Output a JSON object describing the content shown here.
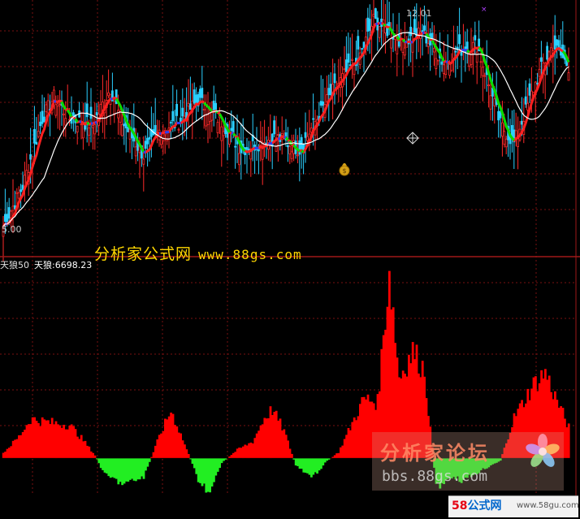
{
  "chart_data": [
    {
      "type": "candlestick",
      "ylim": [
        5.0,
        12.5
      ],
      "price_labels": {
        "low": "5.00",
        "high": "12.01"
      },
      "seed": 7,
      "keypoints": [
        [
          0,
          5.3
        ],
        [
          10,
          6.6
        ],
        [
          20,
          8.8
        ],
        [
          26,
          9.5
        ],
        [
          34,
          8.8
        ],
        [
          46,
          8.6
        ],
        [
          55,
          9.8
        ],
        [
          60,
          8.8
        ],
        [
          72,
          7.6
        ],
        [
          80,
          8.4
        ],
        [
          90,
          8.7
        ],
        [
          100,
          9.4
        ],
        [
          112,
          8.7
        ],
        [
          122,
          7.8
        ],
        [
          140,
          8.2
        ],
        [
          152,
          7.8
        ],
        [
          168,
          9.6
        ],
        [
          184,
          11.0
        ],
        [
          190,
          12.0
        ],
        [
          205,
          11.3
        ],
        [
          215,
          11.6
        ],
        [
          226,
          10.6
        ],
        [
          232,
          11.0
        ],
        [
          243,
          11.2
        ],
        [
          255,
          8.6
        ],
        [
          262,
          8.0
        ],
        [
          275,
          10.3
        ],
        [
          282,
          11.2
        ],
        [
          290,
          10.5
        ]
      ],
      "ma_lines": [
        {
          "name": "",
          "period": 5,
          "color": "#ff2020",
          "width": 3.0
        },
        {
          "name": "",
          "period": 22,
          "color": "#ffffff",
          "width": 1.2
        }
      ],
      "highlight_colors": {
        "down": "#00e000",
        "flat": "#2040ff"
      }
    },
    {
      "type": "bar",
      "indicator_label": "天狼50",
      "series_name": "天狼",
      "series_value": "6698.23",
      "ylim": [
        -1500,
        8000
      ],
      "zero": 0,
      "keypoints": [
        [
          0,
          220
        ],
        [
          8,
          900
        ],
        [
          14,
          1650
        ],
        [
          24,
          1500
        ],
        [
          34,
          1400
        ],
        [
          40,
          850
        ],
        [
          47,
          120
        ],
        [
          52,
          -700
        ],
        [
          62,
          -1100
        ],
        [
          72,
          -800
        ],
        [
          80,
          900
        ],
        [
          86,
          2000
        ],
        [
          90,
          1200
        ],
        [
          96,
          -50
        ],
        [
          100,
          -900
        ],
        [
          106,
          -1450
        ],
        [
          112,
          -200
        ],
        [
          120,
          350
        ],
        [
          128,
          700
        ],
        [
          134,
          1700
        ],
        [
          138,
          2050
        ],
        [
          144,
          1150
        ],
        [
          150,
          -300
        ],
        [
          158,
          -850
        ],
        [
          166,
          -120
        ],
        [
          172,
          250
        ],
        [
          178,
          1300
        ],
        [
          185,
          2500
        ],
        [
          192,
          2350
        ],
        [
          198,
          7900
        ],
        [
          203,
          3400
        ],
        [
          210,
          4500
        ],
        [
          216,
          3700
        ],
        [
          222,
          -1250
        ],
        [
          230,
          -750
        ],
        [
          236,
          -950
        ],
        [
          242,
          -650
        ],
        [
          250,
          -300
        ],
        [
          255,
          -100
        ],
        [
          262,
          1700
        ],
        [
          272,
          3100
        ],
        [
          278,
          3600
        ],
        [
          283,
          2600
        ],
        [
          290,
          1300
        ]
      ],
      "colors": {
        "up": "#ff0000",
        "down": "#22ee22"
      }
    }
  ],
  "watermark_top": {
    "text": "分析家公式网",
    "url": "www.88gs.com"
  },
  "watermark_forum": {
    "text": "分析家论坛",
    "url": "bbs.88gs.com"
  },
  "badge": {
    "num": "58",
    "text": "公式网",
    "url": "www.58gu.com"
  },
  "icons": [
    "flower-logo-icon",
    "money-bag-icon",
    "crosshair-icon"
  ]
}
